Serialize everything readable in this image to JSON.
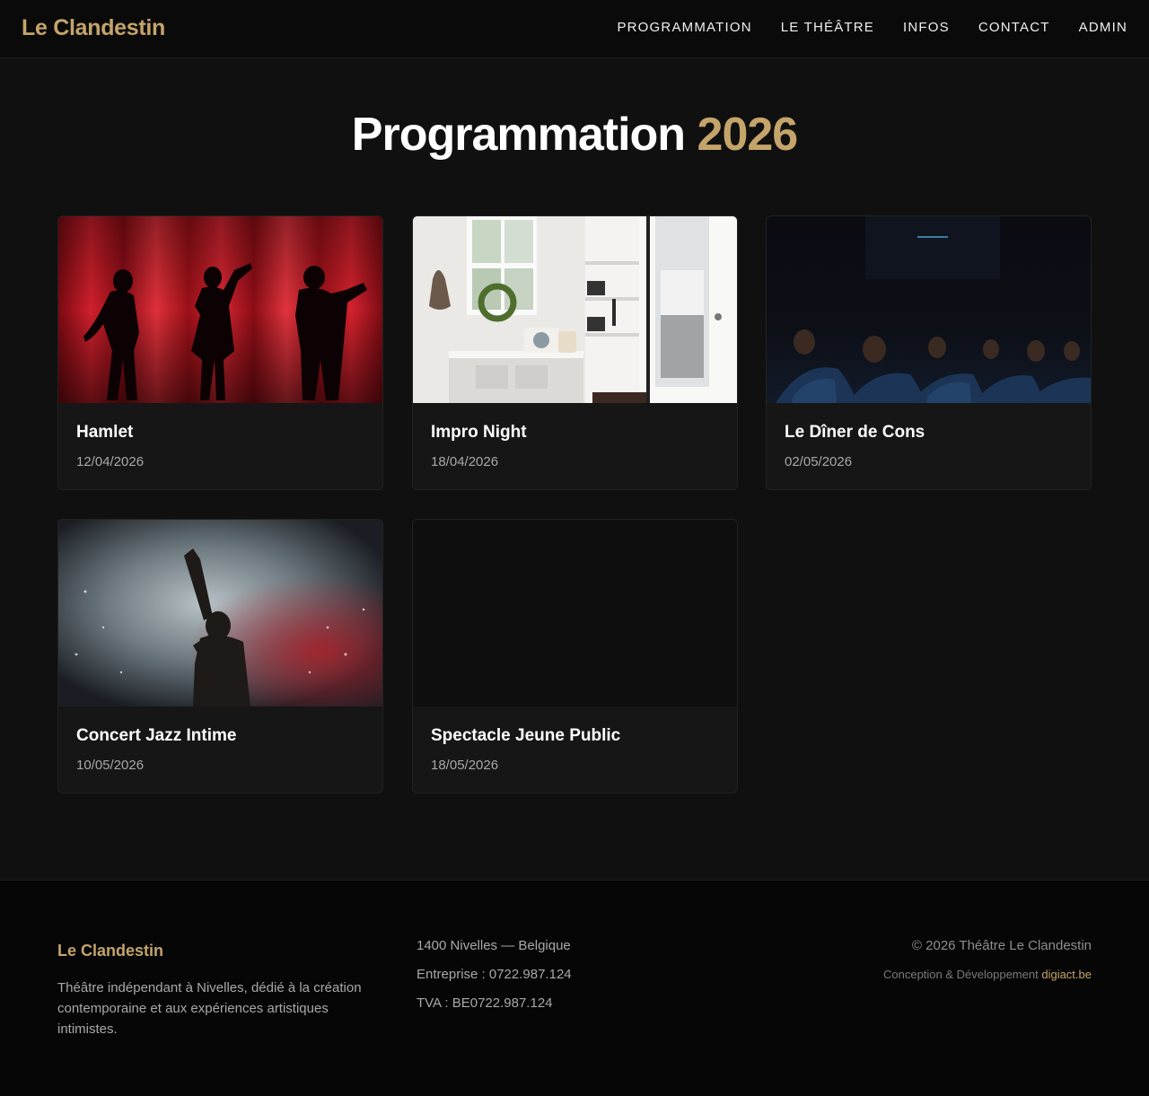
{
  "header": {
    "brand": "Le Clandestin",
    "nav": [
      "PROGRAMMATION",
      "LE THÉÂTRE",
      "INFOS",
      "CONTACT",
      "ADMIN"
    ]
  },
  "page": {
    "title_main": "Programmation",
    "title_year": "2026"
  },
  "events": [
    {
      "title": "Hamlet",
      "date": "12/04/2026",
      "image": "red-curtain-silhouettes"
    },
    {
      "title": "Impro Night",
      "date": "18/04/2026",
      "image": "white-entryway-room"
    },
    {
      "title": "Le Dîner de Cons",
      "date": "02/05/2026",
      "image": "dark-theatre-audience"
    },
    {
      "title": "Concert Jazz Intime",
      "date": "10/05/2026",
      "image": "singer-smoke-stage"
    },
    {
      "title": "Spectacle Jeune Public",
      "date": "18/05/2026",
      "image": "empty-placeholder"
    }
  ],
  "footer": {
    "brand": "Le Clandestin",
    "description": "Théâtre indépendant à Nivelles, dédié à la création contemporaine et aux expériences artistiques intimistes.",
    "address": "1400 Nivelles — Belgique",
    "company": "Entreprise : 0722.987.124",
    "vat": "TVA : BE0722.987.124",
    "copyright": "© 2026 Théâtre Le Clandestin",
    "credit_prefix": "Conception & Développement",
    "credit_link": "digiact.be"
  },
  "colors": {
    "accent": "#c4a46a",
    "background": "#101010",
    "card": "#161616"
  }
}
